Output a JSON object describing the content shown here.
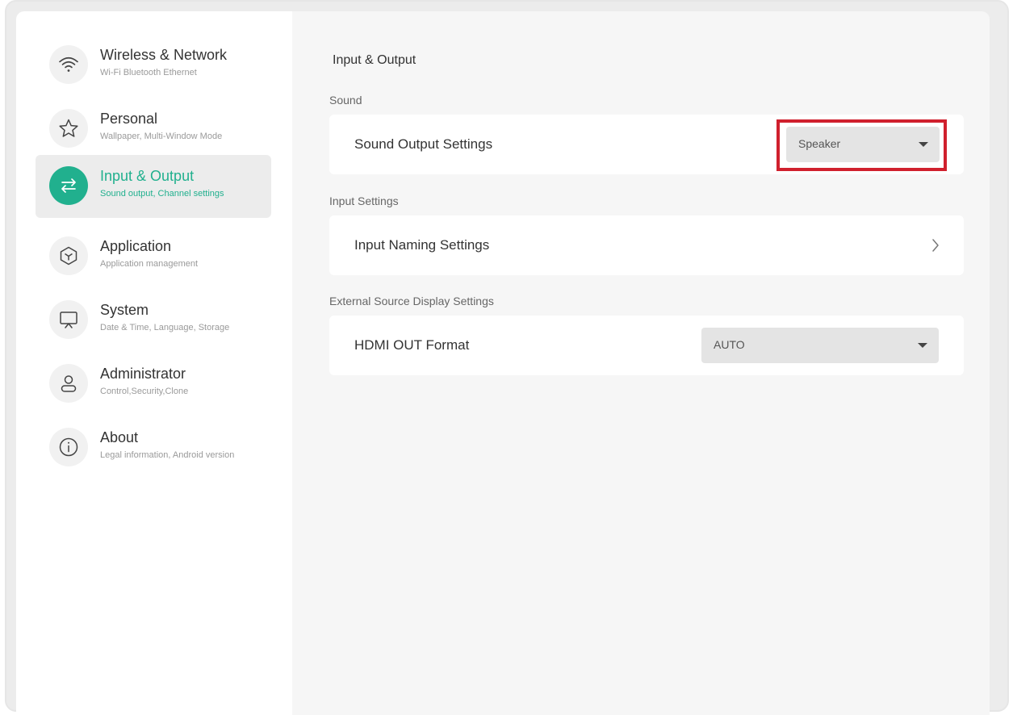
{
  "sidebar": {
    "items": [
      {
        "icon": "wifi-icon",
        "title": "Wireless & Network",
        "subtitle": "Wi-Fi Bluetooth Ethernet",
        "active": false
      },
      {
        "icon": "star-icon",
        "title": "Personal",
        "subtitle": "Wallpaper, Multi-Window Mode",
        "active": false
      },
      {
        "icon": "swap-arrows-icon",
        "title": "Input & Output",
        "subtitle": "Sound output, Channel settings",
        "active": true
      },
      {
        "icon": "cube-icon",
        "title": "Application",
        "subtitle": "Application management",
        "active": false
      },
      {
        "icon": "monitor-icon",
        "title": "System",
        "subtitle": "Date & Time, Language, Storage",
        "active": false
      },
      {
        "icon": "person-icon",
        "title": "Administrator",
        "subtitle": "Control,Security,Clone",
        "active": false
      },
      {
        "icon": "info-icon",
        "title": "About",
        "subtitle": "Legal information, Android version",
        "active": false
      }
    ]
  },
  "main": {
    "title": "Input & Output",
    "sections": {
      "sound": {
        "label": "Sound",
        "row_label": "Sound Output Settings",
        "select_value": "Speaker"
      },
      "input": {
        "label": "Input Settings",
        "row_label": "Input Naming Settings"
      },
      "external": {
        "label": "External Source Display Settings",
        "row_label": "HDMI OUT Format",
        "select_value": "AUTO"
      }
    }
  },
  "colors": {
    "accent": "#21b08e",
    "highlight": "#d0202d"
  }
}
